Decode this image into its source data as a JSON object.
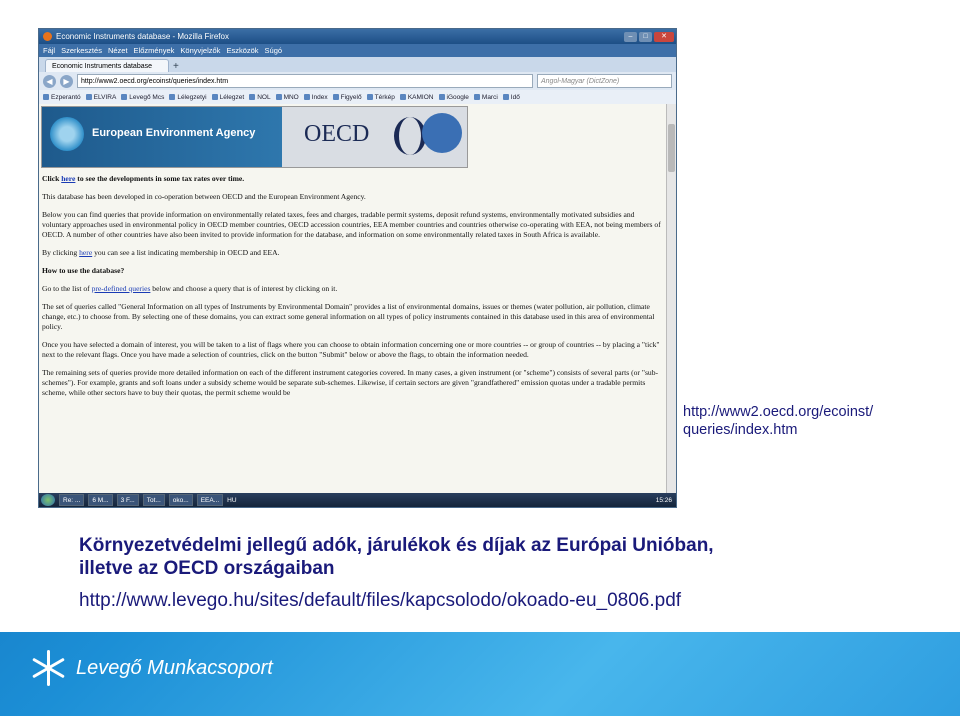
{
  "browser": {
    "window_title": "Economic Instruments database - Mozilla Firefox",
    "window_buttons": [
      "–",
      "□",
      "✕"
    ],
    "menu": [
      "Fájl",
      "Szerkesztés",
      "Nézet",
      "Előzmények",
      "Könyvjelzők",
      "Eszközök",
      "Súgó"
    ],
    "tab_label": "Economic Instruments database",
    "tab_add": "+",
    "nav_back": "◀",
    "nav_forward": "▶",
    "url": "http://www2.oecd.org/ecoinst/queries/index.htm",
    "search_placeholder": "Angol-Magyar (DictZone)",
    "bookmarks": [
      "Ezperantó",
      "ELVIRA",
      "Levegő Mcs",
      "Lélegzetyi",
      "Lélegzet",
      "NOL",
      "MNO",
      "Index",
      "Figyelő",
      "Térkép",
      "KAMION",
      "iGoogle",
      "Marci",
      "Idő"
    ]
  },
  "banner": {
    "agency": "European Environment Agency",
    "oecd": "OECD"
  },
  "document": {
    "p1_pre": "Click ",
    "p1_link": "here",
    "p1_post": " to see the developments in some tax rates over time.",
    "p2": "This database has been developed in co-operation between OECD and the European Environment Agency.",
    "p3": "Below you can find queries that provide information on environmentally related taxes, fees and charges, tradable permit systems, deposit refund systems, environmentally motivated subsidies and voluntary approaches used in environmental policy in OECD member countries, OECD accession countries, EEA member countries and countries otherwise co-operating with EEA, not being members of OECD. A number of other countries have also been invited to provide information for the database, and information on some environmentally related taxes in South Africa is available.",
    "p4_pre": "By clicking ",
    "p4_link": "here",
    "p4_post": " you can see a list indicating membership in OECD and EEA.",
    "h_howto": "How to use the database?",
    "p5_pre": "Go to the list of ",
    "p5_link": "pre-defined queries",
    "p5_post": " below and choose a query that is of interest by clicking on it.",
    "p6": "The set of queries called \"General Information on all types of Instruments by Environmental Domain\" provides a list of environmental domains, issues or themes (water pollution, air pollution, climate change, etc.) to choose from. By selecting one of these domains, you can extract some general information on all types of policy instruments contained in this database used in this area of environmental policy.",
    "p7": "Once you have selected a domain of interest, you will be taken to a list of flags where you can choose to obtain information concerning one or more countries -- or group of countries -- by placing a \"tick\" next to the relevant flags. Once you have made a selection of countries, click on the button \"Submit\" below or above the flags, to obtain the information needed.",
    "p8": "The remaining sets of queries provide more detailed information on each of the different instrument categories covered. In many cases, a given instrument (or \"scheme\") consists of several parts (or \"sub-schemes\"). For example, grants and soft loans under a subsidy scheme would be separate sub-schemes. Likewise, if certain sectors are given \"grandfathered\" emission quotas under a tradable permits scheme, while other sectors have to buy their quotas, the permit scheme would be"
  },
  "taskbar": {
    "items": [
      "Re: ...",
      "6 M...",
      "3 F...",
      "Tot...",
      "oko...",
      "EEA..."
    ],
    "lang": "HU",
    "clock": "15:26"
  },
  "slide": {
    "url_caption_line1": "http://www2.oecd.org/ecoinst/",
    "url_caption_line2": "queries/index.htm",
    "headline_line1": "Környezetvédelmi jellegű adók, járulékok és díjak az Európai Unióban,",
    "headline_line2": "illetve az OECD országaiban",
    "source_link": "http://www.levego.hu/sites/default/files/kapcsolodo/okoado-eu_0806.pdf",
    "logo_text": "Levegő Munkacsoport"
  },
  "colors": {
    "text_navy": "#1a1a7a",
    "background_blue": "#1c8fd6",
    "link_blue": "#1a3bb5"
  }
}
